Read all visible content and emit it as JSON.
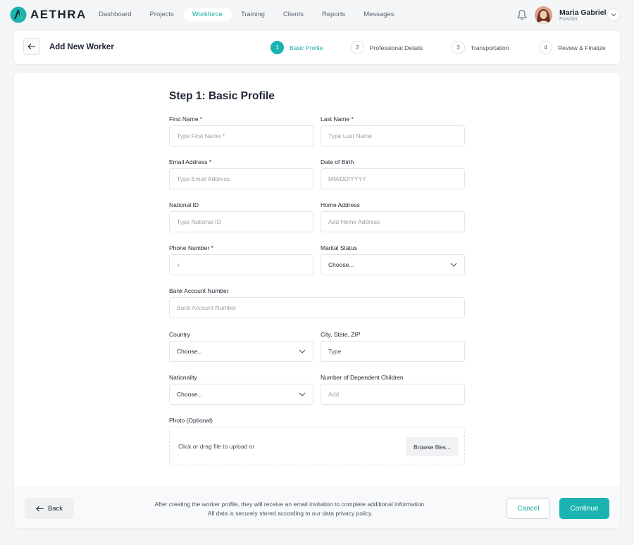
{
  "app": {
    "name": "AETHRA"
  },
  "nav": {
    "links": [
      "Dashboard",
      "Projects",
      "Workforce",
      "Training",
      "Clients",
      "Reports",
      "Messages"
    ],
    "active": "Workforce"
  },
  "user": {
    "name": "Maria Gabriel",
    "role": "Provider"
  },
  "header": {
    "title": "Add New Worker",
    "steps": [
      {
        "num": "1",
        "label": "Basic Profile"
      },
      {
        "num": "2",
        "label": "Professional Details"
      },
      {
        "num": "3",
        "label": "Transportation"
      },
      {
        "num": "4",
        "label": "Review & Finalize"
      }
    ]
  },
  "form": {
    "title": "Step 1: Basic Profile",
    "first_name": {
      "label": "First Name *",
      "placeholder": "Type First Name *"
    },
    "last_name": {
      "label": "Last Name *",
      "placeholder": "Type Last Name"
    },
    "email": {
      "label": "Email Address *",
      "placeholder": "Type Email Address"
    },
    "dob": {
      "label": "Date of Birth",
      "placeholder": "MM/DD/YYYY"
    },
    "national_id": {
      "label": "National ID",
      "placeholder": "Type National ID"
    },
    "home_address": {
      "label": "Home Address",
      "placeholder": "Add Home Address"
    },
    "phone": {
      "label": "Phone Number *",
      "placeholder": "+"
    },
    "marital": {
      "label": "Marital Status",
      "value": "Choose..."
    },
    "bank": {
      "label": "Bank Account Number",
      "placeholder": "Bank Account Number"
    },
    "country": {
      "label": "Country",
      "value": "Choose..."
    },
    "city": {
      "label": "City, State, ZIP",
      "placeholder": "Type"
    },
    "nationality": {
      "label": "Nationality",
      "value": "Choose..."
    },
    "children": {
      "label": "Number of Dependent Children",
      "placeholder": "Add"
    },
    "photo": {
      "label": "Photo (Optional)",
      "hint": "Click or drag file to upload or",
      "browse": "Browse files..."
    }
  },
  "footer": {
    "back": "Back",
    "note_line1": "After creating the worker profile, they will receive an email invitation to complete additional information.",
    "note_line2": "All data is securely stored according to our data privacy policy.",
    "cancel": "Cancel",
    "continue": "Continue"
  },
  "colors": {
    "accent": "#1ab3b0",
    "text": "#1f2733",
    "muted": "#9aa1aa"
  }
}
